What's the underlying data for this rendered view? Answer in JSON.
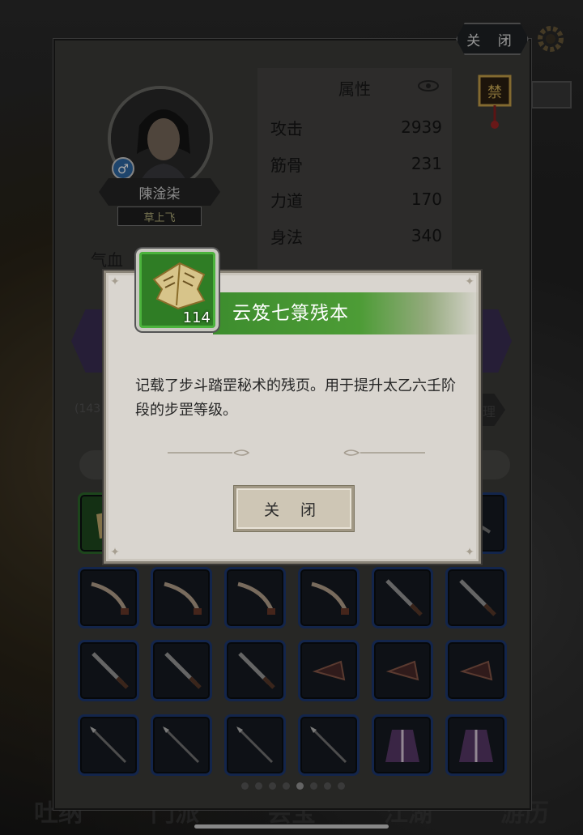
{
  "top": {
    "close_label": "关 闭"
  },
  "character": {
    "name": "陳淦柒",
    "title": "草上飞",
    "gender_symbol": "♂",
    "hp_label": "气血"
  },
  "attributes": {
    "heading": "属性",
    "rows": [
      {
        "label": "攻击",
        "value": "2939"
      },
      {
        "label": "筋骨",
        "value": "231"
      },
      {
        "label": "力道",
        "value": "170"
      },
      {
        "label": "身法",
        "value": "340"
      }
    ]
  },
  "inventory": {
    "count_text": "(143",
    "right_tab_label": "理",
    "pages": 8,
    "active_page": 5
  },
  "dialog": {
    "item_name": "云笈七箓残本",
    "item_count": "114",
    "description": "记载了步斗踏罡秘术的残页。用于提升太乙六壬阶段的步罡等级。",
    "close_label": "关 闭",
    "rarity_color": "#3d8d2e"
  },
  "bottom_nav": [
    "吐纳",
    "门派",
    "会宝",
    "江湖",
    "游历"
  ]
}
